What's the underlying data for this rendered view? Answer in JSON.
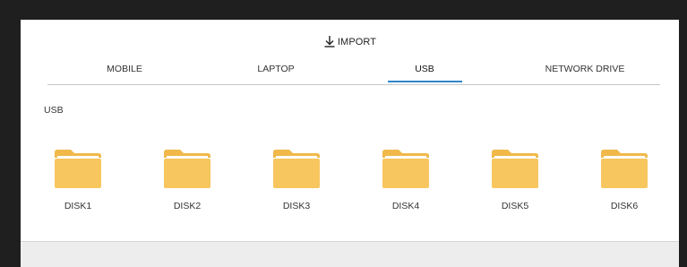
{
  "header": {
    "import_label": "IMPORT",
    "import_icon": "download-icon"
  },
  "tabs": [
    {
      "label": "MOBILE",
      "active": false
    },
    {
      "label": "LAPTOP",
      "active": false
    },
    {
      "label": "USB",
      "active": true
    },
    {
      "label": "NETWORK DRIVE",
      "active": false
    }
  ],
  "section": {
    "title": "USB"
  },
  "disks": [
    {
      "name": "DISK1",
      "icon": "folder-icon"
    },
    {
      "name": "DISK2",
      "icon": "folder-icon"
    },
    {
      "name": "DISK3",
      "icon": "folder-icon"
    },
    {
      "name": "DISK4",
      "icon": "folder-icon"
    },
    {
      "name": "DISK5",
      "icon": "folder-icon"
    },
    {
      "name": "DISK6",
      "icon": "folder-icon"
    }
  ],
  "colors": {
    "accent": "#2f86c8",
    "folder": "#f7c65f",
    "folder_back": "#f0b94a"
  }
}
